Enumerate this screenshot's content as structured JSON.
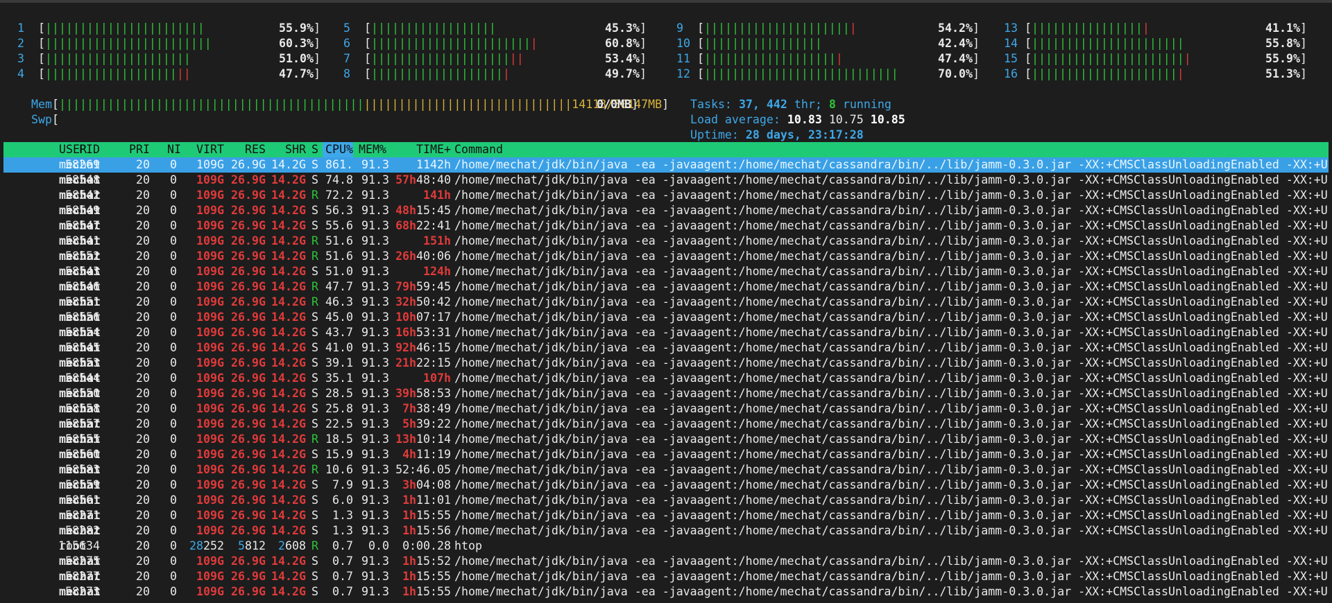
{
  "colors": {
    "background": "#1d1d1d",
    "header_bar": "#1fca77",
    "selected_row": "#3aa0e6",
    "label_blue": "#3ea8e8",
    "green": "#2ec43a",
    "red": "#e03a3a",
    "yellow": "#d7b23a"
  },
  "cpus": [
    {
      "id": "1",
      "percent": "55.9%",
      "green": 23,
      "red": 0
    },
    {
      "id": "2",
      "percent": "60.3%",
      "green": 24,
      "red": 0
    },
    {
      "id": "3",
      "percent": "51.0%",
      "green": 21,
      "red": 0
    },
    {
      "id": "4",
      "percent": "47.7%",
      "green": 19,
      "red": 2
    },
    {
      "id": "5",
      "percent": "45.3%",
      "green": 18,
      "red": 0
    },
    {
      "id": "6",
      "percent": "60.8%",
      "green": 23,
      "red": 1
    },
    {
      "id": "7",
      "percent": "53.4%",
      "green": 20,
      "red": 2
    },
    {
      "id": "8",
      "percent": "49.7%",
      "green": 19,
      "red": 1
    },
    {
      "id": "9",
      "percent": "54.2%",
      "green": 21,
      "red": 1
    },
    {
      "id": "10",
      "percent": "42.4%",
      "green": 17,
      "red": 0
    },
    {
      "id": "11",
      "percent": "47.4%",
      "green": 19,
      "red": 1
    },
    {
      "id": "12",
      "percent": "70.0%",
      "green": 28,
      "red": 0
    },
    {
      "id": "13",
      "percent": "41.1%",
      "green": 16,
      "red": 1
    },
    {
      "id": "14",
      "percent": "55.8%",
      "green": 22,
      "red": 0
    },
    {
      "id": "15",
      "percent": "55.9%",
      "green": 22,
      "red": 1
    },
    {
      "id": "16",
      "percent": "51.3%",
      "green": 21,
      "red": 1
    }
  ],
  "mem": {
    "label": "Mem",
    "value": "14113/30147MB",
    "green": 44,
    "yellow": 30
  },
  "swp": {
    "label": "Swp",
    "value": "0/0MB"
  },
  "tasks": {
    "label": "Tasks:",
    "tasks": "37,",
    "threads": "442",
    "thr": "thr;",
    "running": "8",
    "running_label": "running"
  },
  "load": {
    "label": "Load average:",
    "l1": "10.83",
    "l5": "10.75",
    "l15": "10.85"
  },
  "uptime": {
    "label": "Uptime:",
    "value": "28 days, 23:17:28"
  },
  "columns": {
    "pid": "PID",
    "user": "USER",
    "pri": "PRI",
    "ni": "NI",
    "virt": "VIRT",
    "res": "RES",
    "shr": "SHR",
    "s": "S",
    "cpu": "CPU%",
    "mem": "MEM%",
    "time": "TIME+",
    "command": "Command"
  },
  "java_cmd": "/home/mechat/jdk/bin/java -ea -javaagent:/home/mechat/cassandra/bin/../lib/jamm-0.3.0.jar -XX:+CMSClassUnloadingEnabled -XX:+U",
  "processes": [
    {
      "pid": "58269",
      "user": "mechat",
      "pri": "20",
      "ni": "0",
      "virt": "109G",
      "res": "26.9G",
      "shr": "14.2G",
      "s": "S",
      "cpu": "861.",
      "mem": "91.3",
      "th": "",
      "tr": "1142h",
      "cmd": "java",
      "selected": true
    },
    {
      "pid": "58548",
      "user": "mechat",
      "pri": "20",
      "ni": "0",
      "virt": "109G",
      "res": "26.9G",
      "shr": "14.2G",
      "s": "S",
      "cpu": "74.8",
      "mem": "91.3",
      "th": "57h",
      "tr": "48:40",
      "cmd": "java"
    },
    {
      "pid": "58542",
      "user": "mechat",
      "pri": "20",
      "ni": "0",
      "virt": "109G",
      "res": "26.9G",
      "shr": "14.2G",
      "s": "R",
      "cpu": "72.2",
      "mem": "91.3",
      "th": "141h",
      "tr": "",
      "cmd": "java"
    },
    {
      "pid": "58549",
      "user": "mechat",
      "pri": "20",
      "ni": "0",
      "virt": "109G",
      "res": "26.9G",
      "shr": "14.2G",
      "s": "S",
      "cpu": "56.3",
      "mem": "91.3",
      "th": "48h",
      "tr": "15:45",
      "cmd": "java"
    },
    {
      "pid": "58547",
      "user": "mechat",
      "pri": "20",
      "ni": "0",
      "virt": "109G",
      "res": "26.9G",
      "shr": "14.2G",
      "s": "S",
      "cpu": "55.6",
      "mem": "91.3",
      "th": "68h",
      "tr": "22:41",
      "cmd": "java"
    },
    {
      "pid": "58541",
      "user": "mechat",
      "pri": "20",
      "ni": "0",
      "virt": "109G",
      "res": "26.9G",
      "shr": "14.2G",
      "s": "R",
      "cpu": "51.6",
      "mem": "91.3",
      "th": "151h",
      "tr": "",
      "cmd": "java"
    },
    {
      "pid": "58552",
      "user": "mechat",
      "pri": "20",
      "ni": "0",
      "virt": "109G",
      "res": "26.9G",
      "shr": "14.2G",
      "s": "R",
      "cpu": "51.6",
      "mem": "91.3",
      "th": "26h",
      "tr": "40:06",
      "cmd": "java"
    },
    {
      "pid": "58543",
      "user": "mechat",
      "pri": "20",
      "ni": "0",
      "virt": "109G",
      "res": "26.9G",
      "shr": "14.2G",
      "s": "S",
      "cpu": "51.0",
      "mem": "91.3",
      "th": "124h",
      "tr": "",
      "cmd": "java"
    },
    {
      "pid": "58546",
      "user": "mechat",
      "pri": "20",
      "ni": "0",
      "virt": "109G",
      "res": "26.9G",
      "shr": "14.2G",
      "s": "R",
      "cpu": "47.7",
      "mem": "91.3",
      "th": "79h",
      "tr": "59:45",
      "cmd": "java"
    },
    {
      "pid": "58551",
      "user": "mechat",
      "pri": "20",
      "ni": "0",
      "virt": "109G",
      "res": "26.9G",
      "shr": "14.2G",
      "s": "R",
      "cpu": "46.3",
      "mem": "91.3",
      "th": "32h",
      "tr": "50:42",
      "cmd": "java"
    },
    {
      "pid": "58556",
      "user": "mechat",
      "pri": "20",
      "ni": "0",
      "virt": "109G",
      "res": "26.9G",
      "shr": "14.2G",
      "s": "S",
      "cpu": "45.0",
      "mem": "91.3",
      "th": "10h",
      "tr": "07:17",
      "cmd": "java"
    },
    {
      "pid": "58554",
      "user": "mechat",
      "pri": "20",
      "ni": "0",
      "virt": "109G",
      "res": "26.9G",
      "shr": "14.2G",
      "s": "S",
      "cpu": "43.7",
      "mem": "91.3",
      "th": "16h",
      "tr": "53:31",
      "cmd": "java"
    },
    {
      "pid": "58545",
      "user": "mechat",
      "pri": "20",
      "ni": "0",
      "virt": "109G",
      "res": "26.9G",
      "shr": "14.2G",
      "s": "S",
      "cpu": "41.0",
      "mem": "91.3",
      "th": "92h",
      "tr": "46:15",
      "cmd": "java"
    },
    {
      "pid": "58553",
      "user": "mechat",
      "pri": "20",
      "ni": "0",
      "virt": "109G",
      "res": "26.9G",
      "shr": "14.2G",
      "s": "S",
      "cpu": "39.1",
      "mem": "91.3",
      "th": "21h",
      "tr": "22:15",
      "cmd": "java"
    },
    {
      "pid": "58544",
      "user": "mechat",
      "pri": "20",
      "ni": "0",
      "virt": "109G",
      "res": "26.9G",
      "shr": "14.2G",
      "s": "S",
      "cpu": "35.1",
      "mem": "91.3",
      "th": "107h",
      "tr": "",
      "cmd": "java"
    },
    {
      "pid": "58550",
      "user": "mechat",
      "pri": "20",
      "ni": "0",
      "virt": "109G",
      "res": "26.9G",
      "shr": "14.2G",
      "s": "S",
      "cpu": "28.5",
      "mem": "91.3",
      "th": "39h",
      "tr": "58:53",
      "cmd": "java"
    },
    {
      "pid": "58558",
      "user": "mechat",
      "pri": "20",
      "ni": "0",
      "virt": "109G",
      "res": "26.9G",
      "shr": "14.2G",
      "s": "S",
      "cpu": "25.8",
      "mem": "91.3",
      "th": "7h",
      "tr": "38:49",
      "cmd": "java"
    },
    {
      "pid": "58557",
      "user": "mechat",
      "pri": "20",
      "ni": "0",
      "virt": "109G",
      "res": "26.9G",
      "shr": "14.2G",
      "s": "S",
      "cpu": "22.5",
      "mem": "91.3",
      "th": "5h",
      "tr": "39:22",
      "cmd": "java"
    },
    {
      "pid": "58555",
      "user": "mechat",
      "pri": "20",
      "ni": "0",
      "virt": "109G",
      "res": "26.9G",
      "shr": "14.2G",
      "s": "R",
      "cpu": "18.5",
      "mem": "91.3",
      "th": "13h",
      "tr": "10:14",
      "cmd": "java"
    },
    {
      "pid": "58560",
      "user": "mechat",
      "pri": "20",
      "ni": "0",
      "virt": "109G",
      "res": "26.9G",
      "shr": "14.2G",
      "s": "S",
      "cpu": "15.9",
      "mem": "91.3",
      "th": "4h",
      "tr": "11:19",
      "cmd": "java"
    },
    {
      "pid": "58583",
      "user": "mechat",
      "pri": "20",
      "ni": "0",
      "virt": "109G",
      "res": "26.9G",
      "shr": "14.2G",
      "s": "R",
      "cpu": "10.6",
      "mem": "91.3",
      "th": "",
      "tr": "52:46.05",
      "cmd": "java"
    },
    {
      "pid": "58559",
      "user": "mechat",
      "pri": "20",
      "ni": "0",
      "virt": "109G",
      "res": "26.9G",
      "shr": "14.2G",
      "s": "S",
      "cpu": "7.9",
      "mem": "91.3",
      "th": "3h",
      "tr": "04:08",
      "cmd": "java"
    },
    {
      "pid": "58561",
      "user": "mechat",
      "pri": "20",
      "ni": "0",
      "virt": "109G",
      "res": "26.9G",
      "shr": "14.2G",
      "s": "S",
      "cpu": "6.0",
      "mem": "91.3",
      "th": "1h",
      "tr": "11:01",
      "cmd": "java"
    },
    {
      "pid": "58271",
      "user": "mechat",
      "pri": "20",
      "ni": "0",
      "virt": "109G",
      "res": "26.9G",
      "shr": "14.2G",
      "s": "S",
      "cpu": "1.3",
      "mem": "91.3",
      "th": "1h",
      "tr": "15:55",
      "cmd": "java"
    },
    {
      "pid": "58282",
      "user": "mechat",
      "pri": "20",
      "ni": "0",
      "virt": "109G",
      "res": "26.9G",
      "shr": "14.2G",
      "s": "S",
      "cpu": "1.3",
      "mem": "91.3",
      "th": "1h",
      "tr": "15:56",
      "cmd": "java"
    },
    {
      "pid": "115634",
      "user": "root",
      "pri": "20",
      "ni": "0",
      "virt": "28252",
      "res": "5812",
      "shr": "2608",
      "s": "R",
      "cpu": "0.7",
      "mem": "0.0",
      "th": "",
      "tr": "0:00.28",
      "cmd": "htop",
      "plain": true
    },
    {
      "pid": "58275",
      "user": "mechat",
      "pri": "20",
      "ni": "0",
      "virt": "109G",
      "res": "26.9G",
      "shr": "14.2G",
      "s": "S",
      "cpu": "0.7",
      "mem": "91.3",
      "th": "1h",
      "tr": "15:52",
      "cmd": "java"
    },
    {
      "pid": "58277",
      "user": "mechat",
      "pri": "20",
      "ni": "0",
      "virt": "109G",
      "res": "26.9G",
      "shr": "14.2G",
      "s": "S",
      "cpu": "0.7",
      "mem": "91.3",
      "th": "1h",
      "tr": "15:55",
      "cmd": "java"
    },
    {
      "pid": "58273",
      "user": "mechat",
      "pri": "20",
      "ni": "0",
      "virt": "109G",
      "res": "26.9G",
      "shr": "14.2G",
      "s": "S",
      "cpu": "0.7",
      "mem": "91.3",
      "th": "1h",
      "tr": "15:55",
      "cmd": "java"
    }
  ]
}
